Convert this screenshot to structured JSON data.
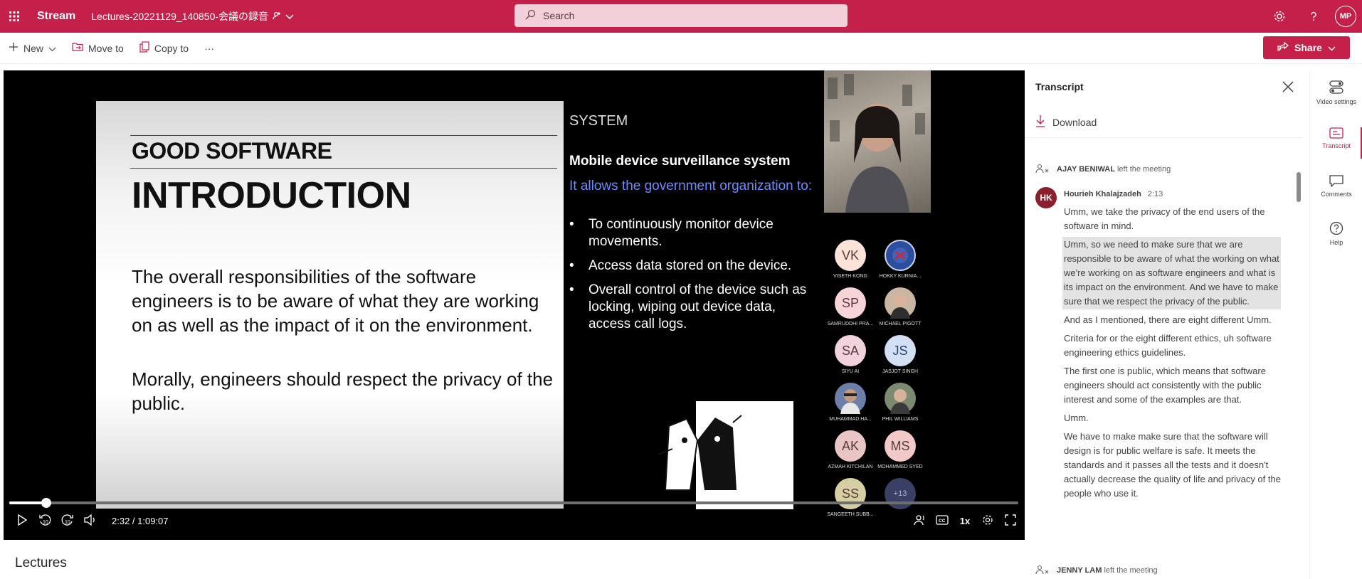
{
  "app": {
    "brand": "Stream",
    "doc_title": "Lectures-20221129_140850-会議の録音",
    "search_placeholder": "Search",
    "user_initials": "MP"
  },
  "toolbar": {
    "new_label": "New",
    "move_label": "Move to",
    "copy_label": "Copy to",
    "more_label": "···",
    "share_label": "Share"
  },
  "slide": {
    "left_title": "GOOD SOFTWARE",
    "left_heading": "INTRODUCTION",
    "para1": "The overall responsibilities of the software engineers is to be aware of what they are working on as well as the impact of it on the environment.",
    "para2": "Morally, engineers should respect the privacy of the public.",
    "right_label": "SYSTEM",
    "right_title": "Mobile device surveillance system",
    "right_subtitle": "It allows the government organization to:",
    "bullets": [
      "To continuously monitor device movements.",
      "Access data stored on the device.",
      "Overall control of the device such as locking, wiping out device data, access call logs."
    ]
  },
  "participants": [
    {
      "initials": "VK",
      "name": "VISETH KONG",
      "bg": "#fbe3d8"
    },
    {
      "initials": "",
      "name": "HOKKY KURNIA...",
      "bg": "#2b4f9e"
    },
    {
      "initials": "SP",
      "name": "SAMRUDDHI PRA...",
      "bg": "#f6d4d8"
    },
    {
      "initials": "",
      "name": "MICHAEL PIGOTT",
      "bg": "#c9b7a3"
    },
    {
      "initials": "SA",
      "name": "SIYU AI",
      "bg": "#f1d3dd"
    },
    {
      "initials": "JS",
      "name": "JASJOT SINGH",
      "bg": "#d3e0f4"
    },
    {
      "initials": "",
      "name": "MUHAMMAD HA...",
      "bg": "#6b7fa8"
    },
    {
      "initials": "",
      "name": "PHIL WILLIAMS",
      "bg": "#7c8a70"
    },
    {
      "initials": "AK",
      "name": "AZMAH KITCHILAN",
      "bg": "#e9c5c5"
    },
    {
      "initials": "MS",
      "name": "MOHAMMED SYED",
      "bg": "#f1c9c9"
    },
    {
      "initials": "SS",
      "name": "SANGEETH SUBB...",
      "bg": "#d5cfa3"
    },
    {
      "initials": "+13",
      "name": "",
      "bg": "#3a3f66"
    }
  ],
  "player": {
    "time_display": "2:32 / 1:09:07",
    "progress_fraction": 0.0366,
    "speed": "1x",
    "skip_back": "10",
    "skip_fwd": "10"
  },
  "page": {
    "section_title": "Lectures"
  },
  "transcript": {
    "title": "Transcript",
    "download_label": "Download",
    "event_top": {
      "name": "AJAY BENIWAL",
      "text": "left the meeting"
    },
    "speaker": {
      "initials": "HK",
      "name": "Hourieh Khalajzadeh",
      "time": "2:13"
    },
    "segments": [
      "Umm, we take the privacy of the end users of the software in mind.",
      "Umm, so we need to make sure that we are responsible to be aware of what the working on what we're working on as software engineers and what is its impact on the environment. And we have to make sure that we respect the privacy of the public.",
      "And as I mentioned, there are eight different Umm.",
      "Criteria for or the eight different ethics, uh software engineering ethics guidelines.",
      "The first one is public, which means that software engineers should act consistently with the public interest and some of the examples are that.",
      "Umm.",
      "We have to make make sure that the software will design is for public welfare is safe. It meets the standards and it passes all the tests and it doesn't actually decrease the quality of life and privacy of the people who use it."
    ],
    "event_bottom": {
      "name": "JENNY LAM",
      "text": "left the meeting"
    }
  },
  "rail": {
    "video_settings": "Video settings",
    "transcript": "Transcript",
    "comments": "Comments",
    "help": "Help"
  },
  "colors": {
    "brand": "#c4204a",
    "search_bg": "#f2d0da",
    "slide_blue": "#6a8cff"
  }
}
